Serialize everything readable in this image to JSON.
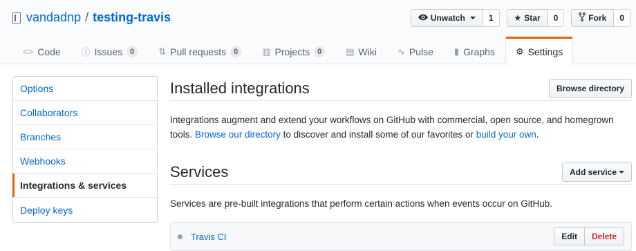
{
  "repo": {
    "owner": "vandadnp",
    "separator": "/",
    "name": "testing-travis"
  },
  "actions": {
    "watch": {
      "label": "Unwatch",
      "count": "1"
    },
    "star": {
      "label": "Star",
      "count": "0"
    },
    "fork": {
      "label": "Fork",
      "count": "0"
    }
  },
  "nav": [
    {
      "icon": "<>",
      "label": "Code",
      "count": ""
    },
    {
      "icon": "ⓘ",
      "label": "Issues",
      "count": "0"
    },
    {
      "icon": "⇅",
      "label": "Pull requests",
      "count": "0"
    },
    {
      "icon": "▥",
      "label": "Projects",
      "count": "0"
    },
    {
      "icon": "▤",
      "label": "Wiki",
      "count": ""
    },
    {
      "icon": "∿",
      "label": "Pulse",
      "count": ""
    },
    {
      "icon": "▮",
      "label": "Graphs",
      "count": ""
    },
    {
      "icon": "⚙",
      "label": "Settings",
      "count": ""
    }
  ],
  "menu": [
    "Options",
    "Collaborators",
    "Branches",
    "Webhooks",
    "Integrations & services",
    "Deploy keys"
  ],
  "integrations": {
    "title": "Installed integrations",
    "browse_button": "Browse directory",
    "text_before": "Integrations augment and extend your workflows on GitHub with commercial, open source, and homegrown tools. ",
    "link1": "Browse our directory",
    "text_middle": " to discover and install some of our favorites or ",
    "link2": "build your own",
    "text_after": "."
  },
  "services": {
    "title": "Services",
    "add_button": "Add service",
    "description": "Services are pre-built integrations that perform certain actions when events occur on GitHub.",
    "items": [
      {
        "name": "Travis CI",
        "edit_label": "Edit",
        "delete_label": "Delete"
      }
    ]
  }
}
